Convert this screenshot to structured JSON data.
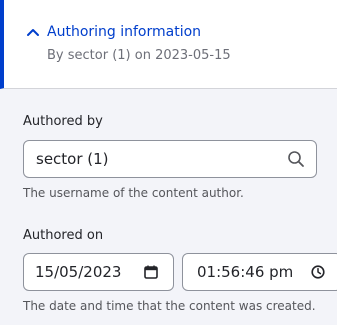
{
  "summary": {
    "title": "Authoring information",
    "subtitle": "By sector (1) on 2023-05-15",
    "icon": "chevron-up-icon",
    "accent_color": "#003ecc"
  },
  "authored_by": {
    "label": "Authored by",
    "value": "sector (1)",
    "icon": "search-icon",
    "description": "The username of the content author."
  },
  "authored_on": {
    "label": "Authored on",
    "date_value": "15/05/2023",
    "date_icon": "calendar-icon",
    "time_value": "01:56:46 pm",
    "time_icon": "clock-icon",
    "description": "The date and time that the content was created."
  }
}
